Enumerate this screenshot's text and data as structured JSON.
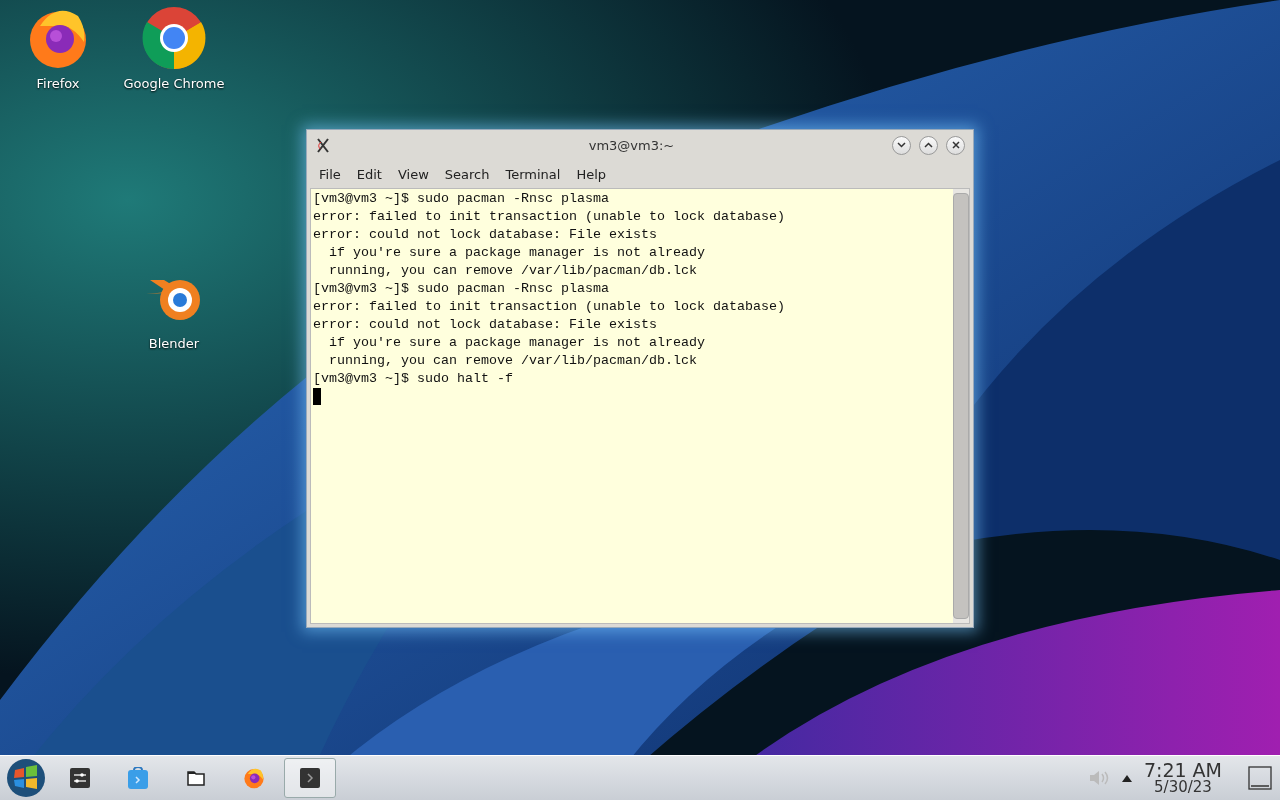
{
  "desktop_icons": [
    {
      "kind": "firefox",
      "label": "Firefox"
    },
    {
      "kind": "chrome",
      "label": "Google Chrome"
    },
    {
      "kind": "blender",
      "label": "Blender"
    }
  ],
  "window": {
    "title": "vm3@vm3:~",
    "menu": [
      "File",
      "Edit",
      "View",
      "Search",
      "Terminal",
      "Help"
    ],
    "lines": [
      "[vm3@vm3 ~]$ sudo pacman -Rnsc plasma",
      "error: failed to init transaction (unable to lock database)",
      "error: could not lock database: File exists",
      "  if you're sure a package manager is not already",
      "  running, you can remove /var/lib/pacman/db.lck",
      "[vm3@vm3 ~]$ sudo pacman -Rnsc plasma",
      "error: failed to init transaction (unable to lock database)",
      "error: could not lock database: File exists",
      "  if you're sure a package manager is not already",
      "  running, you can remove /var/lib/pacman/db.lck",
      "[vm3@vm3 ~]$ sudo halt -f"
    ],
    "cursor_visible": true
  },
  "taskbar": {
    "launchers": [
      {
        "kind": "settings",
        "selected": false
      },
      {
        "kind": "store",
        "selected": false
      },
      {
        "kind": "folder",
        "selected": false
      },
      {
        "kind": "firefox",
        "selected": false
      },
      {
        "kind": "terminal",
        "selected": true
      }
    ],
    "clock": {
      "time": "7:21 AM",
      "date": "5/30/23"
    }
  }
}
